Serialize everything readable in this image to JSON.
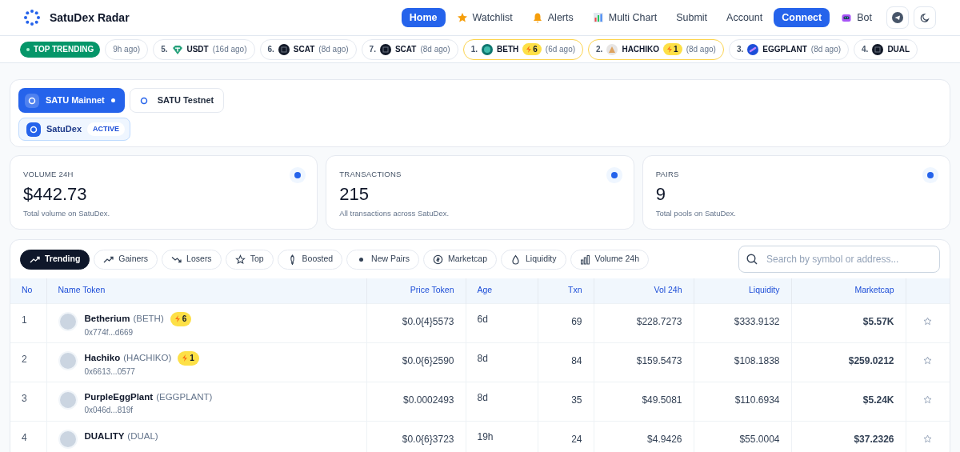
{
  "brand": {
    "name": "SatuDex Radar"
  },
  "nav": [
    {
      "label": "Home",
      "kind": "link",
      "selected": true
    },
    {
      "label": "Watchlist",
      "kind": "star",
      "selected": false
    },
    {
      "label": "Alerts",
      "kind": "bell",
      "selected": false
    },
    {
      "label": "Multi Chart",
      "kind": "chart",
      "selected": false
    },
    {
      "label": "Submit",
      "kind": "link",
      "selected": false
    },
    {
      "label": "Account",
      "kind": "link",
      "selected": false
    },
    {
      "label": "Connect",
      "kind": "primary",
      "selected": false
    },
    {
      "label": "Bot",
      "kind": "bot",
      "selected": false
    }
  ],
  "ticker": {
    "badge": "TOP TRENDING",
    "items": [
      {
        "age": "9h ago)"
      },
      {
        "rank": "5.",
        "symbol": "USDT",
        "age": "(16d ago)"
      },
      {
        "rank": "6.",
        "symbol": "SCAT",
        "age": "(8d ago)"
      },
      {
        "rank": "7.",
        "symbol": "SCAT",
        "age": "(8d ago)"
      },
      {
        "rank": "1.",
        "symbol": "BETH",
        "boost": "6",
        "age": "(6d ago)"
      },
      {
        "rank": "2.",
        "symbol": "HACHIKO",
        "boost": "1",
        "age": "(8d ago)"
      },
      {
        "rank": "3.",
        "symbol": "EGGPLANT",
        "age": "(8d ago)"
      },
      {
        "rank": "4.",
        "symbol": "DUAL"
      }
    ]
  },
  "networks": {
    "chains": [
      {
        "label": "SATU Mainnet",
        "selected": true
      },
      {
        "label": "SATU Testnet",
        "selected": false
      }
    ],
    "dexes": [
      {
        "label": "SatuDex",
        "badge": "ACTIVE",
        "selected": true
      }
    ]
  },
  "stats": [
    {
      "label": "VOLUME 24H",
      "value": "$442.73",
      "caption": "Total volume on SatuDex."
    },
    {
      "label": "TRANSACTIONS",
      "value": "215",
      "caption": "All transactions across SatuDex."
    },
    {
      "label": "PAIRS",
      "value": "9",
      "caption": "Total pools on SatuDex."
    }
  ],
  "filters": [
    {
      "label": "Trending",
      "kind": "trend",
      "selected": true
    },
    {
      "label": "Gainers",
      "kind": "trend",
      "selected": false
    },
    {
      "label": "Losers",
      "kind": "down",
      "selected": false
    },
    {
      "label": "Top",
      "kind": "star",
      "selected": false
    },
    {
      "label": "Boosted",
      "kind": "rocket",
      "selected": false
    },
    {
      "label": "New Pairs",
      "kind": "dot",
      "selected": false
    },
    {
      "label": "Marketcap",
      "kind": "coin",
      "selected": false
    },
    {
      "label": "Liquidity",
      "kind": "drop",
      "selected": false
    },
    {
      "label": "Volume 24h",
      "kind": "bars",
      "selected": false
    }
  ],
  "search": {
    "placeholder": "Search by symbol or address..."
  },
  "table": {
    "columns": [
      "No",
      "Name Token",
      "Price Token",
      "Age",
      "Txn",
      "Vol 24h",
      "Liquidity",
      "Marketcap"
    ],
    "rows": [
      {
        "no": "1",
        "name": "Betherium",
        "symbol": "(BETH)",
        "boost": "6",
        "address": "0x774f...d669",
        "price": "$0.0{4}5573",
        "age": "6d",
        "txn": "69",
        "vol": "$228.7273",
        "liquidity": "$333.9132",
        "marketcap": "$5.57K"
      },
      {
        "no": "2",
        "name": "Hachiko",
        "symbol": "(HACHIKO)",
        "boost": "1",
        "address": "0x6613...0577",
        "price": "$0.0{6}2590",
        "age": "8d",
        "txn": "84",
        "vol": "$159.5473",
        "liquidity": "$108.1838",
        "marketcap": "$259.0212"
      },
      {
        "no": "3",
        "name": "PurpleEggPlant",
        "symbol": "(EGGPLANT)",
        "address": "0x046d...819f",
        "price": "$0.0002493",
        "age": "8d",
        "txn": "35",
        "vol": "$49.5081",
        "liquidity": "$110.6934",
        "marketcap": "$5.24K"
      },
      {
        "no": "4",
        "name": "DUALITY",
        "symbol": "(DUAL)",
        "price": "$0.0{6}3723",
        "age": "19h",
        "txn": "24",
        "vol": "$4.9426",
        "liquidity": "$55.0004",
        "marketcap": "$37.2326"
      }
    ]
  }
}
